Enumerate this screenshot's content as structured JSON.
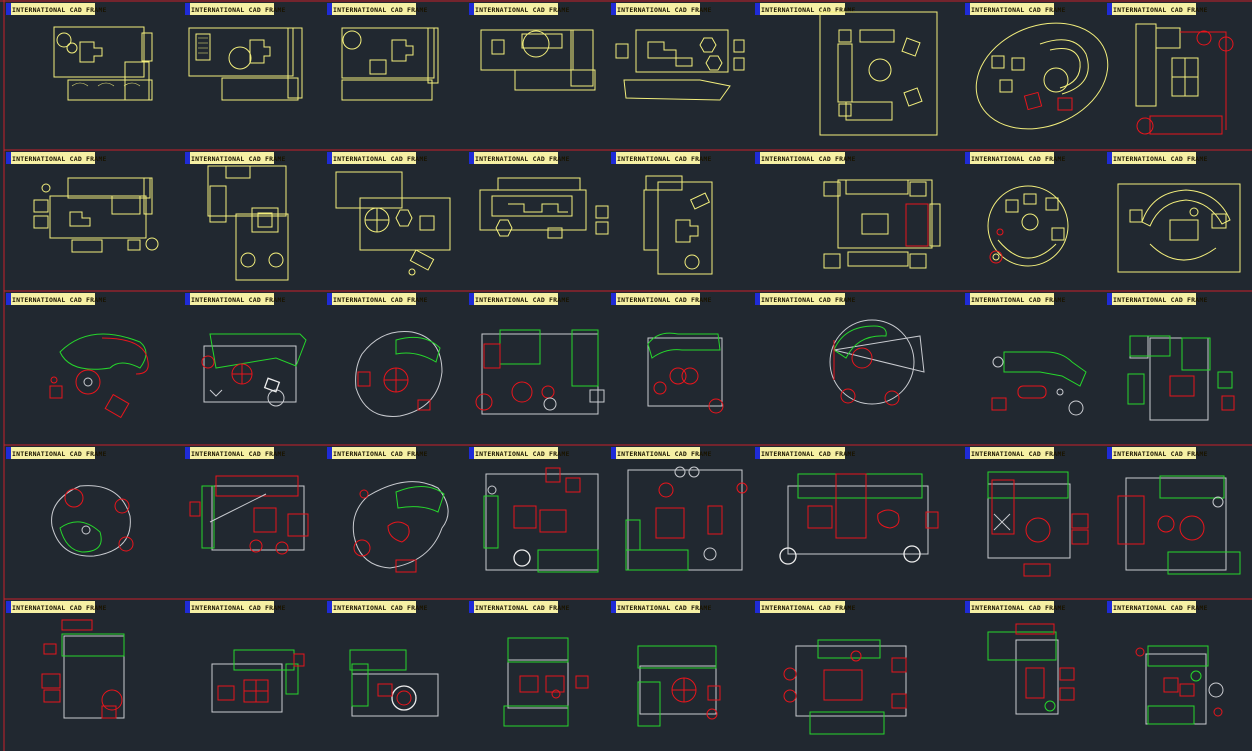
{
  "drawing": {
    "background": "#212830",
    "colors": {
      "yellow": "#f2ee7c",
      "red": "#e8151c",
      "green": "#26d62c",
      "white": "#c9cbd0",
      "frame_blue": "#1f2bd6",
      "frame_cream": "#f6f0a4"
    },
    "frames": [
      {
        "label": "INTERNATIONAL CAD FRAME"
      },
      {
        "label": "INTERNATIONAL CAD FRAME"
      },
      {
        "label": "INTERNATIONAL CAD FRAME"
      },
      {
        "label": "INTERNATIONAL CAD FRAME"
      },
      {
        "label": "INTERNATIONAL CAD FRAME"
      },
      {
        "label": "INTERNATIONAL CAD FRAME"
      },
      {
        "label": "INTERNATIONAL CAD FRAME"
      },
      {
        "label": "INTERNATIONAL CAD FRAME"
      },
      {
        "label": "INTERNATIONAL CAD FRAME"
      },
      {
        "label": "INTERNATIONAL CAD FRAME"
      },
      {
        "label": "INTERNATIONAL CAD FRAME"
      },
      {
        "label": "INTERNATIONAL CAD FRAME"
      },
      {
        "label": "INTERNATIONAL CAD FRAME"
      },
      {
        "label": "INTERNATIONAL CAD FRAME"
      },
      {
        "label": "INTERNATIONAL CAD FRAME"
      },
      {
        "label": "INTERNATIONAL CAD FRAME"
      },
      {
        "label": "INTERNATIONAL CAD FRAME"
      },
      {
        "label": "INTERNATIONAL CAD FRAME"
      },
      {
        "label": "INTERNATIONAL CAD FRAME"
      },
      {
        "label": "INTERNATIONAL CAD FRAME"
      },
      {
        "label": "INTERNATIONAL CAD FRAME"
      },
      {
        "label": "INTERNATIONAL CAD FRAME"
      },
      {
        "label": "INTERNATIONAL CAD FRAME"
      },
      {
        "label": "INTERNATIONAL CAD FRAME"
      },
      {
        "label": "INTERNATIONAL CAD FRAME"
      },
      {
        "label": "INTERNATIONAL CAD FRAME"
      },
      {
        "label": "INTERNATIONAL CAD FRAME"
      },
      {
        "label": "INTERNATIONAL CAD FRAME"
      },
      {
        "label": "INTERNATIONAL CAD FRAME"
      },
      {
        "label": "INTERNATIONAL CAD FRAME"
      },
      {
        "label": "INTERNATIONAL CAD FRAME"
      },
      {
        "label": "INTERNATIONAL CAD FRAME"
      },
      {
        "label": "INTERNATIONAL CAD FRAME"
      },
      {
        "label": "INTERNATIONAL CAD FRAME"
      },
      {
        "label": "INTERNATIONAL CAD FRAME"
      },
      {
        "label": "INTERNATIONAL CAD FRAME"
      },
      {
        "label": "INTERNATIONAL CAD FRAME"
      },
      {
        "label": "INTERNATIONAL CAD FRAME"
      },
      {
        "label": "INTERNATIONAL CAD FRAME"
      },
      {
        "label": "INTERNATIONAL CAD FRAME"
      }
    ]
  }
}
